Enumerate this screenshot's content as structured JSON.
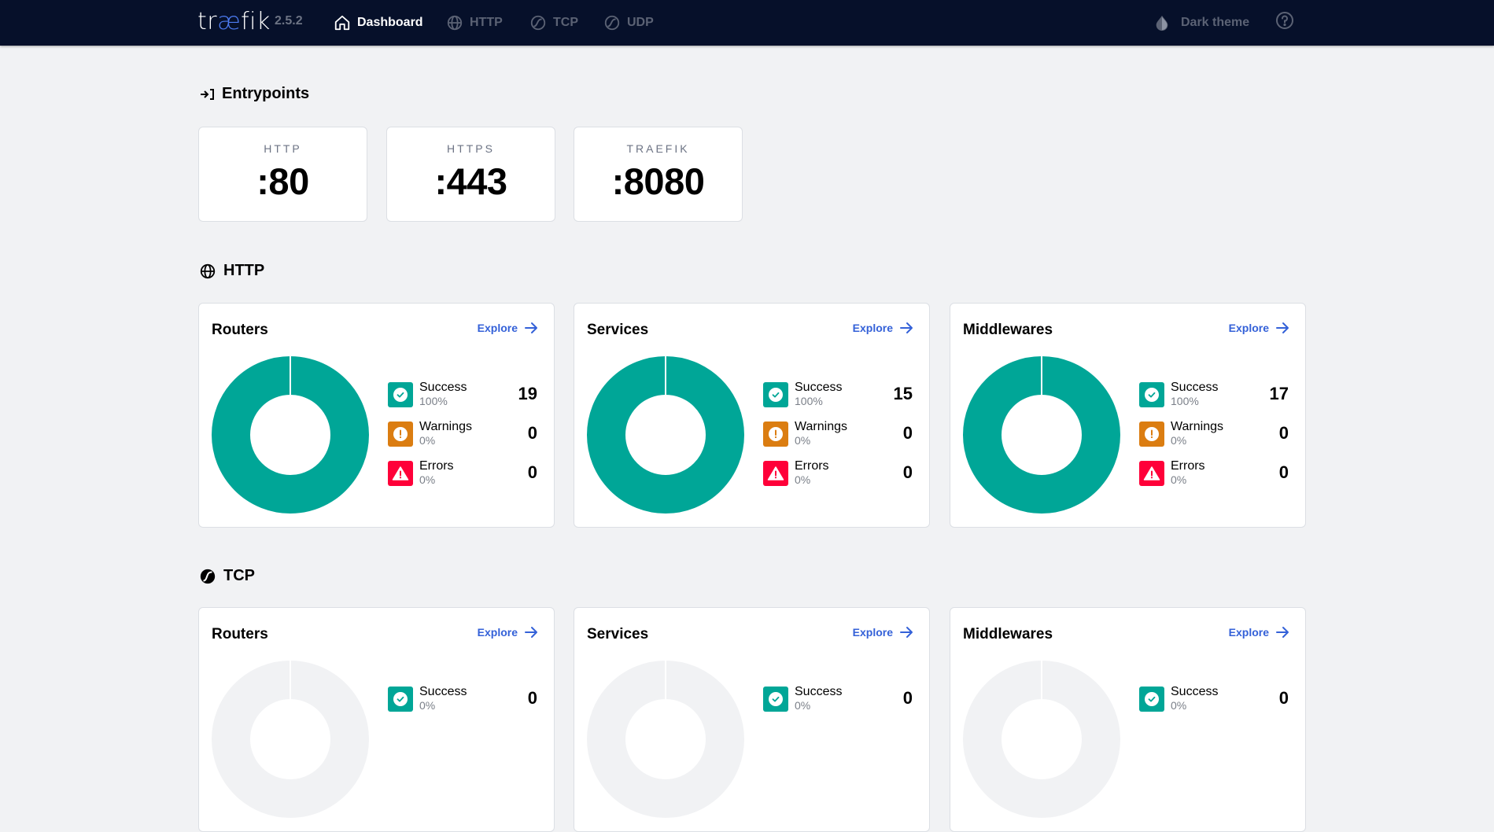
{
  "header": {
    "logo": {
      "pre": "tr",
      "accent": "æ",
      "post": "fik"
    },
    "version": "2.5.2",
    "nav": [
      {
        "label": "Dashboard",
        "icon": "home-icon",
        "active": true
      },
      {
        "label": "HTTP",
        "icon": "globe-icon",
        "active": false
      },
      {
        "label": "TCP",
        "icon": "tcp-icon",
        "active": false
      },
      {
        "label": "UDP",
        "icon": "udp-icon",
        "active": false
      }
    ],
    "theme_label": "Dark theme",
    "help_icon": "help-circle-icon"
  },
  "colors": {
    "topbar": "#06102a",
    "accent": "#4d7cf3",
    "link": "#3461d8",
    "success": "#00a697",
    "warning": "#db7d11",
    "error": "#ff0039",
    "empty": "#f1f2f4"
  },
  "entrypoints": {
    "title": "Entrypoints",
    "items": [
      {
        "name": "HTTP",
        "port": ":80"
      },
      {
        "name": "HTTPS",
        "port": ":443"
      },
      {
        "name": "TRAEFIK",
        "port": ":8080"
      }
    ]
  },
  "sections": [
    {
      "title": "HTTP",
      "cards": [
        {
          "title": "Routers",
          "explore": "Explore",
          "stats": [
            {
              "label": "Success",
              "pct": "100%",
              "count": "19"
            },
            {
              "label": "Warnings",
              "pct": "0%",
              "count": "0"
            },
            {
              "label": "Errors",
              "pct": "0%",
              "count": "0"
            }
          ]
        },
        {
          "title": "Services",
          "explore": "Explore",
          "stats": [
            {
              "label": "Success",
              "pct": "100%",
              "count": "15"
            },
            {
              "label": "Warnings",
              "pct": "0%",
              "count": "0"
            },
            {
              "label": "Errors",
              "pct": "0%",
              "count": "0"
            }
          ]
        },
        {
          "title": "Middlewares",
          "explore": "Explore",
          "stats": [
            {
              "label": "Success",
              "pct": "100%",
              "count": "17"
            },
            {
              "label": "Warnings",
              "pct": "0%",
              "count": "0"
            },
            {
              "label": "Errors",
              "pct": "0%",
              "count": "0"
            }
          ]
        }
      ]
    },
    {
      "title": "TCP",
      "cards": [
        {
          "title": "Routers",
          "explore": "Explore",
          "stats": [
            {
              "label": "Success",
              "pct": "0%",
              "count": "0"
            }
          ]
        },
        {
          "title": "Services",
          "explore": "Explore",
          "stats": [
            {
              "label": "Success",
              "pct": "0%",
              "count": "0"
            }
          ]
        },
        {
          "title": "Middlewares",
          "explore": "Explore",
          "stats": [
            {
              "label": "Success",
              "pct": "0%",
              "count": "0"
            }
          ]
        }
      ]
    }
  ]
}
